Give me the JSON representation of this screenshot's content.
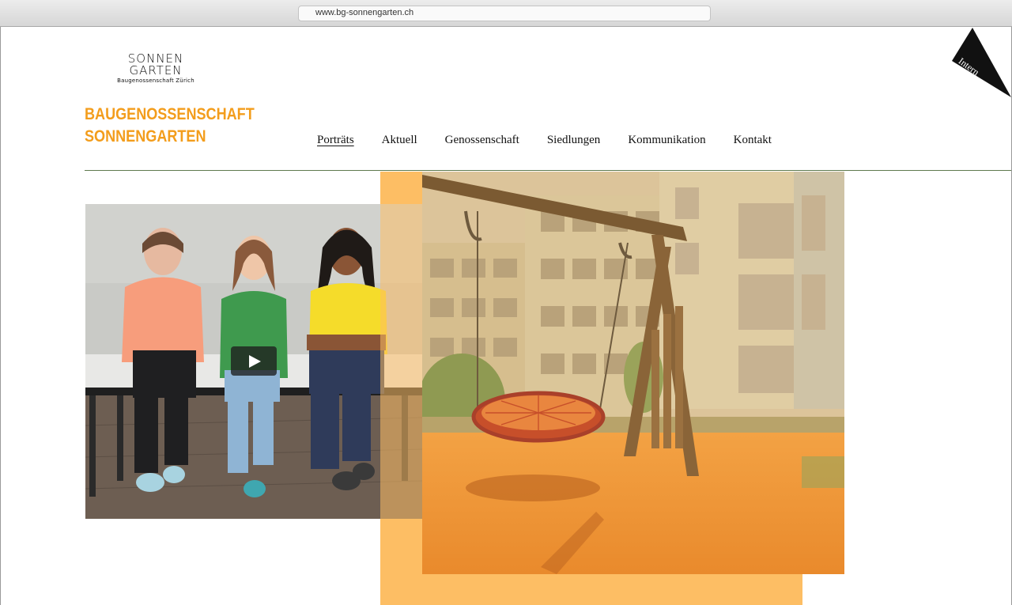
{
  "browser": {
    "url": "www.bg-sonnengarten.ch"
  },
  "logo": {
    "line1": "SONNEN",
    "line2": "GARTEN",
    "subtitle": "Baugenossenschaft Zürich"
  },
  "site_title": {
    "line1": "BAUGENOSSENSCHAFT",
    "line2": "SONNENGARTEN"
  },
  "nav": {
    "items": [
      {
        "label": "Porträts",
        "active": true
      },
      {
        "label": "Aktuell",
        "active": false
      },
      {
        "label": "Genossenschaft",
        "active": false
      },
      {
        "label": "Siedlungen",
        "active": false
      },
      {
        "label": "Kommunikation",
        "active": false
      },
      {
        "label": "Kontakt",
        "active": false
      }
    ]
  },
  "intern": {
    "label": "Intern"
  },
  "hero": {
    "video_icon": "play-icon",
    "photo_icon": "playground-swing-photo"
  },
  "colors": {
    "brand_orange": "#f39d1c",
    "accent_light_orange": "#fdbe64",
    "divider_green": "#5f7a4f"
  }
}
